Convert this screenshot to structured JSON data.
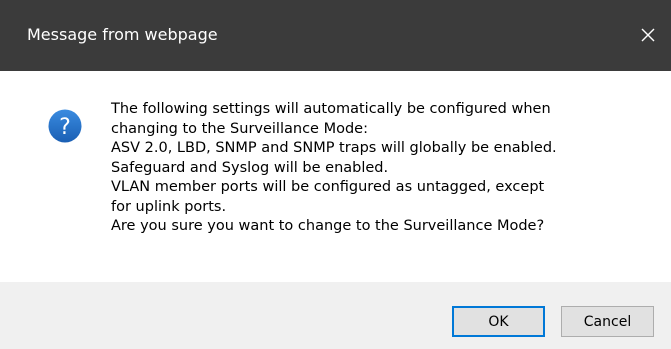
{
  "dialog": {
    "title": "Message from webpage",
    "close_icon": "close-icon",
    "message_icon": "question-icon",
    "message_lines": [
      "The following settings will automatically be configured when",
      "changing to the Surveillance Mode:",
      "ASV 2.0, LBD, SNMP and SNMP traps will globally be enabled.",
      "Safeguard and Syslog will be enabled.",
      "VLAN member ports will be configured as untagged, except",
      "for uplink ports.",
      "Are you sure you want to change to the Surveillance Mode?"
    ],
    "buttons": {
      "ok_label": "OK",
      "cancel_label": "Cancel"
    },
    "colors": {
      "titlebar_bg": "#3b3b3b",
      "title_text": "#ffffff",
      "footer_bg": "#f0f0f0",
      "icon_blue": "#1e6fc8",
      "default_button_border": "#0078d7"
    }
  }
}
